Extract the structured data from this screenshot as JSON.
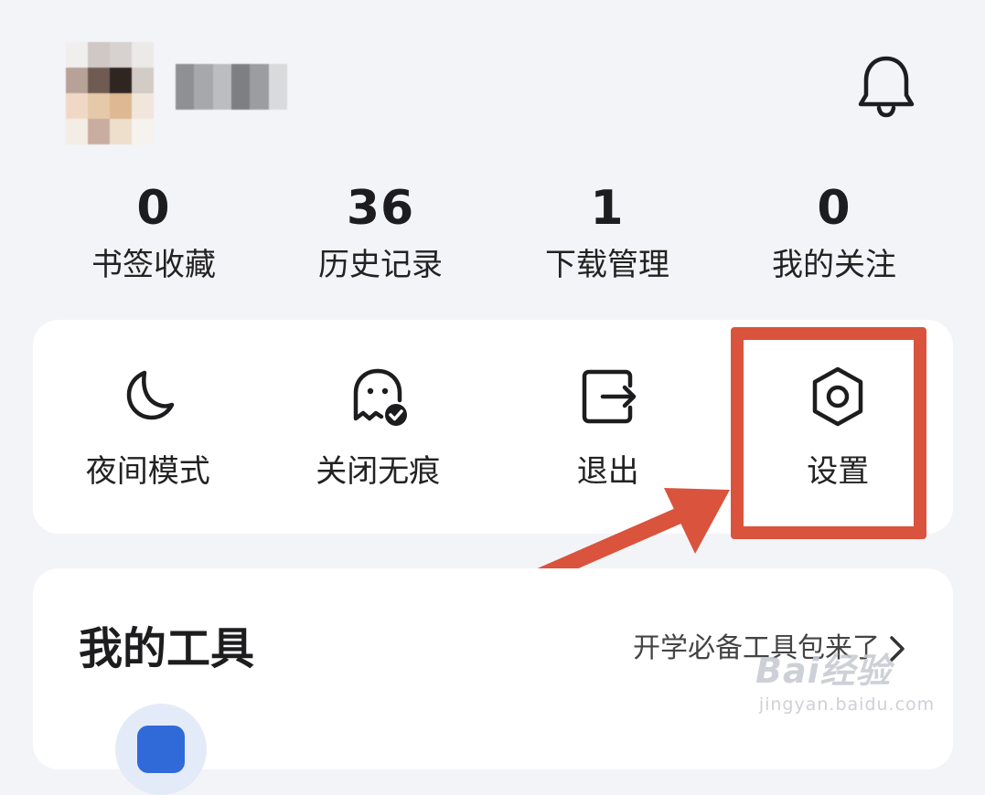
{
  "profile": {
    "username_hidden": true
  },
  "stats": [
    {
      "value": "0",
      "label": "书签收藏"
    },
    {
      "value": "36",
      "label": "历史记录"
    },
    {
      "value": "1",
      "label": "下载管理"
    },
    {
      "value": "0",
      "label": "我的关注"
    }
  ],
  "quick_actions": [
    {
      "label": "夜间模式",
      "icon": "moon-icon"
    },
    {
      "label": "关闭无痕",
      "icon": "ghost-check-icon"
    },
    {
      "label": "退出",
      "icon": "exit-icon"
    },
    {
      "label": "设置",
      "icon": "settings-hexagon-icon"
    }
  ],
  "tools": {
    "title": "我的工具",
    "link_text": "开学必备工具包来了"
  },
  "watermark": {
    "main": "Bai经验",
    "sub": "jingyan.baidu.com"
  },
  "colors": {
    "background": "#f3f4f7",
    "card": "#ffffff",
    "annotation": "#d9533d",
    "tool_accent": "#2f6ad8"
  }
}
